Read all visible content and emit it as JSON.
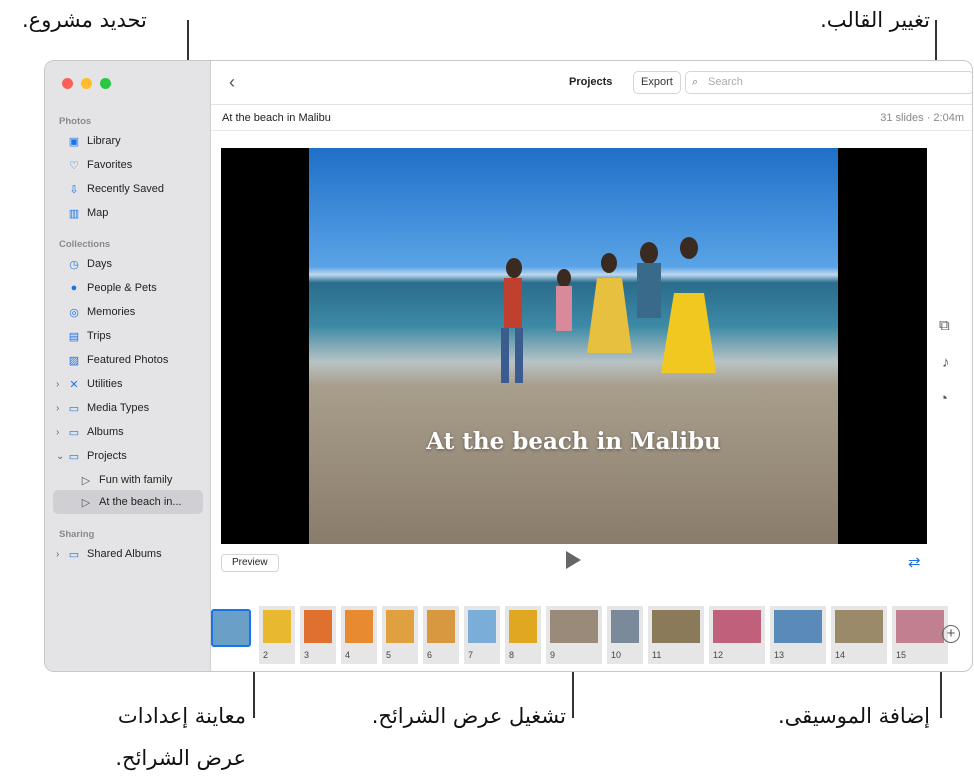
{
  "callouts": {
    "select_project": "تحديد مشروع.",
    "change_theme": "تغيير القالب.",
    "preview_settings_1": "معاينة إعدادات",
    "preview_settings_2": "عرض الشرائح.",
    "play": "تشغيل عرض الشرائح.",
    "add_music": "إضافة الموسيقى."
  },
  "sidebar": {
    "photos_header": "Photos",
    "photos": [
      {
        "label": "Library",
        "icon": "library-icon"
      },
      {
        "label": "Favorites",
        "icon": "heart-icon"
      },
      {
        "label": "Recently Saved",
        "icon": "download-icon"
      },
      {
        "label": "Map",
        "icon": "map-icon"
      }
    ],
    "collections_header": "Collections",
    "collections": [
      {
        "label": "Days"
      },
      {
        "label": "People & Pets"
      },
      {
        "label": "Memories"
      },
      {
        "label": "Trips"
      },
      {
        "label": "Featured Photos"
      },
      {
        "label": "Utilities"
      },
      {
        "label": "Media Types"
      },
      {
        "label": "Albums"
      },
      {
        "label": "Projects"
      },
      {
        "label": "Fun with family"
      },
      {
        "label": "At the beach in..."
      }
    ],
    "sharing_header": "Sharing",
    "sharing": [
      {
        "label": "Shared Albums"
      }
    ]
  },
  "toolbar": {
    "title": "Projects",
    "export": "Export",
    "search_placeholder": "Search"
  },
  "project": {
    "name": "At the beach in Malibu",
    "info": "31 slides · 2:04m",
    "caption": "At the beach in Malibu",
    "preview": "Preview"
  },
  "slides": [
    {
      "n": "",
      "c": "#6aa0c8"
    },
    {
      "n": "2",
      "c": "#e8b830"
    },
    {
      "n": "3",
      "c": "#e07030"
    },
    {
      "n": "4",
      "c": "#e88a30"
    },
    {
      "n": "5",
      "c": "#e0a040"
    },
    {
      "n": "6",
      "c": "#d89840"
    },
    {
      "n": "7",
      "c": "#7aaed8"
    },
    {
      "n": "8",
      "c": "#e0a820"
    },
    {
      "n": "9",
      "c": "#9a8a7a"
    },
    {
      "n": "10",
      "c": "#7a8a9a"
    },
    {
      "n": "11",
      "c": "#8a7a5a"
    },
    {
      "n": "12",
      "c": "#c0607a"
    },
    {
      "n": "13",
      "c": "#5a8ab8"
    },
    {
      "n": "14",
      "c": "#9a8a6a"
    },
    {
      "n": "15",
      "c": "#c08090"
    }
  ]
}
